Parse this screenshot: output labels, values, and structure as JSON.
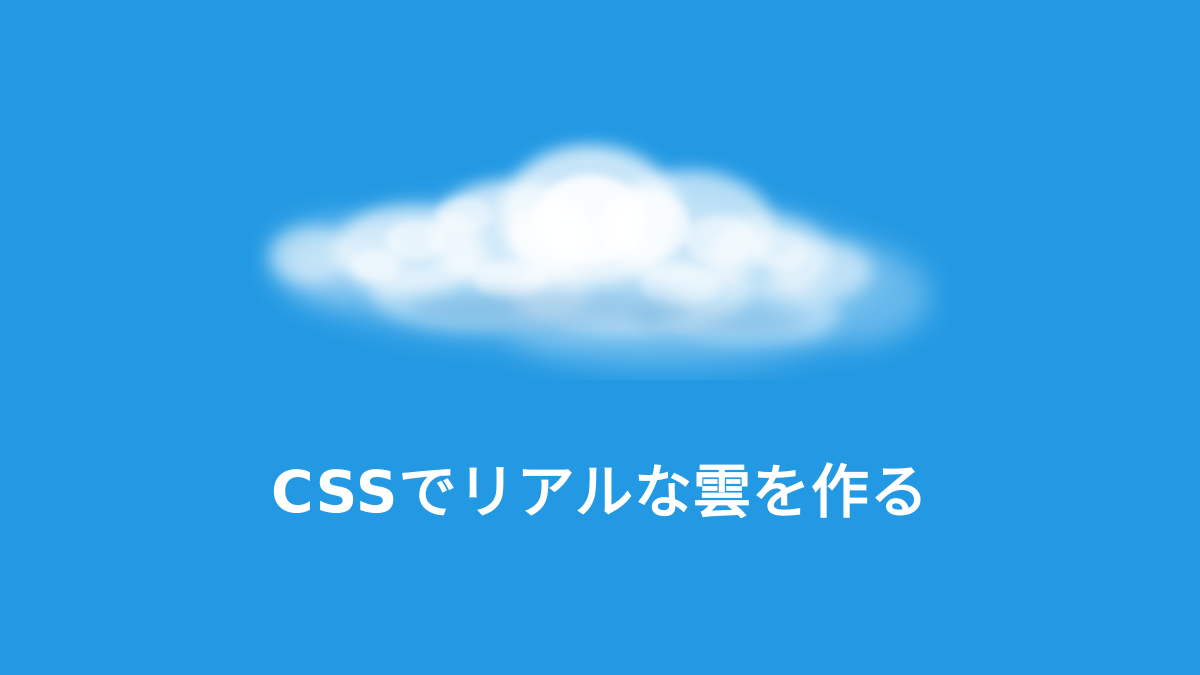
{
  "page": {
    "background_color": "#2399e3"
  },
  "hero": {
    "title": "CSSでリアルな雲を作る",
    "title_color": "#ffffff"
  },
  "illustration": {
    "icon": "cloud-icon",
    "color": "#ffffff"
  }
}
